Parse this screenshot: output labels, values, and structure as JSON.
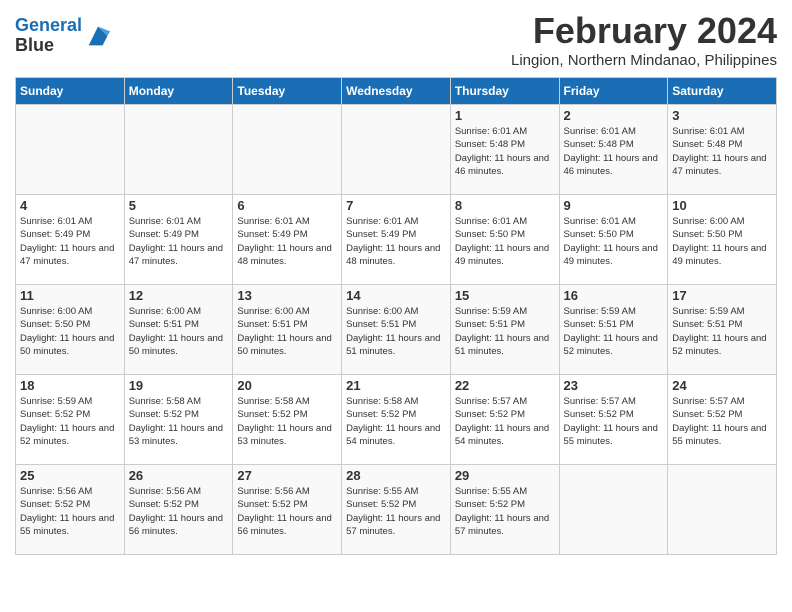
{
  "header": {
    "logo_line1": "General",
    "logo_line2": "Blue",
    "month": "February 2024",
    "location": "Lingion, Northern Mindanao, Philippines"
  },
  "columns": [
    "Sunday",
    "Monday",
    "Tuesday",
    "Wednesday",
    "Thursday",
    "Friday",
    "Saturday"
  ],
  "weeks": [
    [
      {
        "day": "",
        "info": ""
      },
      {
        "day": "",
        "info": ""
      },
      {
        "day": "",
        "info": ""
      },
      {
        "day": "",
        "info": ""
      },
      {
        "day": "1",
        "info": "Sunrise: 6:01 AM\nSunset: 5:48 PM\nDaylight: 11 hours and 46 minutes."
      },
      {
        "day": "2",
        "info": "Sunrise: 6:01 AM\nSunset: 5:48 PM\nDaylight: 11 hours and 46 minutes."
      },
      {
        "day": "3",
        "info": "Sunrise: 6:01 AM\nSunset: 5:48 PM\nDaylight: 11 hours and 47 minutes."
      }
    ],
    [
      {
        "day": "4",
        "info": "Sunrise: 6:01 AM\nSunset: 5:49 PM\nDaylight: 11 hours and 47 minutes."
      },
      {
        "day": "5",
        "info": "Sunrise: 6:01 AM\nSunset: 5:49 PM\nDaylight: 11 hours and 47 minutes."
      },
      {
        "day": "6",
        "info": "Sunrise: 6:01 AM\nSunset: 5:49 PM\nDaylight: 11 hours and 48 minutes."
      },
      {
        "day": "7",
        "info": "Sunrise: 6:01 AM\nSunset: 5:49 PM\nDaylight: 11 hours and 48 minutes."
      },
      {
        "day": "8",
        "info": "Sunrise: 6:01 AM\nSunset: 5:50 PM\nDaylight: 11 hours and 49 minutes."
      },
      {
        "day": "9",
        "info": "Sunrise: 6:01 AM\nSunset: 5:50 PM\nDaylight: 11 hours and 49 minutes."
      },
      {
        "day": "10",
        "info": "Sunrise: 6:00 AM\nSunset: 5:50 PM\nDaylight: 11 hours and 49 minutes."
      }
    ],
    [
      {
        "day": "11",
        "info": "Sunrise: 6:00 AM\nSunset: 5:50 PM\nDaylight: 11 hours and 50 minutes."
      },
      {
        "day": "12",
        "info": "Sunrise: 6:00 AM\nSunset: 5:51 PM\nDaylight: 11 hours and 50 minutes."
      },
      {
        "day": "13",
        "info": "Sunrise: 6:00 AM\nSunset: 5:51 PM\nDaylight: 11 hours and 50 minutes."
      },
      {
        "day": "14",
        "info": "Sunrise: 6:00 AM\nSunset: 5:51 PM\nDaylight: 11 hours and 51 minutes."
      },
      {
        "day": "15",
        "info": "Sunrise: 5:59 AM\nSunset: 5:51 PM\nDaylight: 11 hours and 51 minutes."
      },
      {
        "day": "16",
        "info": "Sunrise: 5:59 AM\nSunset: 5:51 PM\nDaylight: 11 hours and 52 minutes."
      },
      {
        "day": "17",
        "info": "Sunrise: 5:59 AM\nSunset: 5:51 PM\nDaylight: 11 hours and 52 minutes."
      }
    ],
    [
      {
        "day": "18",
        "info": "Sunrise: 5:59 AM\nSunset: 5:52 PM\nDaylight: 11 hours and 52 minutes."
      },
      {
        "day": "19",
        "info": "Sunrise: 5:58 AM\nSunset: 5:52 PM\nDaylight: 11 hours and 53 minutes."
      },
      {
        "day": "20",
        "info": "Sunrise: 5:58 AM\nSunset: 5:52 PM\nDaylight: 11 hours and 53 minutes."
      },
      {
        "day": "21",
        "info": "Sunrise: 5:58 AM\nSunset: 5:52 PM\nDaylight: 11 hours and 54 minutes."
      },
      {
        "day": "22",
        "info": "Sunrise: 5:57 AM\nSunset: 5:52 PM\nDaylight: 11 hours and 54 minutes."
      },
      {
        "day": "23",
        "info": "Sunrise: 5:57 AM\nSunset: 5:52 PM\nDaylight: 11 hours and 55 minutes."
      },
      {
        "day": "24",
        "info": "Sunrise: 5:57 AM\nSunset: 5:52 PM\nDaylight: 11 hours and 55 minutes."
      }
    ],
    [
      {
        "day": "25",
        "info": "Sunrise: 5:56 AM\nSunset: 5:52 PM\nDaylight: 11 hours and 55 minutes."
      },
      {
        "day": "26",
        "info": "Sunrise: 5:56 AM\nSunset: 5:52 PM\nDaylight: 11 hours and 56 minutes."
      },
      {
        "day": "27",
        "info": "Sunrise: 5:56 AM\nSunset: 5:52 PM\nDaylight: 11 hours and 56 minutes."
      },
      {
        "day": "28",
        "info": "Sunrise: 5:55 AM\nSunset: 5:52 PM\nDaylight: 11 hours and 57 minutes."
      },
      {
        "day": "29",
        "info": "Sunrise: 5:55 AM\nSunset: 5:52 PM\nDaylight: 11 hours and 57 minutes."
      },
      {
        "day": "",
        "info": ""
      },
      {
        "day": "",
        "info": ""
      }
    ]
  ]
}
